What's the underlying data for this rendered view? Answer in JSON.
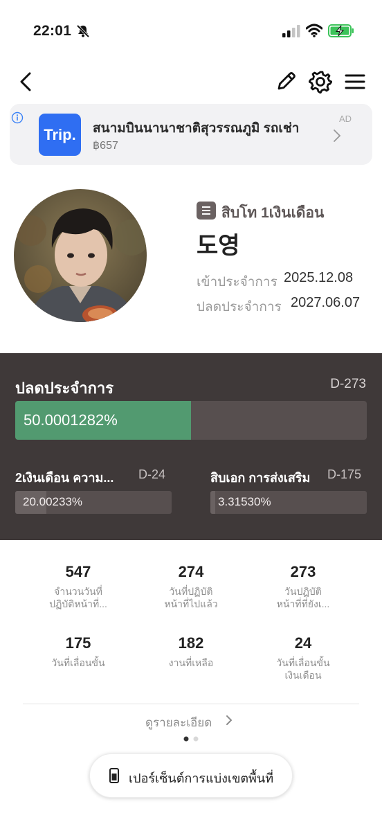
{
  "status_bar": {
    "time": "22:01"
  },
  "ad": {
    "logo_text": "Trip.",
    "title": "สนามบินนานาชาติสุวรรณภูมิ รถเช่า",
    "price": "฿657",
    "tag": "AD"
  },
  "profile": {
    "rank": "สิบโท 1เงินเดือน",
    "name": "도영",
    "enlist_label": "เข้าประจำการ",
    "enlist_date": "2025.12.08",
    "discharge_label": "ปลดประจำการ",
    "discharge_date": "2027.06.07"
  },
  "progress": {
    "main": {
      "label": "ปลดประจำการ",
      "dday": "D-273",
      "percent_text": "50.0001282%",
      "percent": 50.0001282
    },
    "sub1": {
      "label": "2เงินเดือน ความ...",
      "dday": "D-24",
      "percent_text": "20.00233%",
      "percent": 20.00233
    },
    "sub2": {
      "label": "สิบเอก การส่งเสริม",
      "dday": "D-175",
      "percent_text": "3.31530%",
      "percent": 3.3153
    }
  },
  "stats": [
    {
      "value": "547",
      "label_line1": "จำนวนวันที่",
      "label_line2": "ปฏิบัติหน้าที่..."
    },
    {
      "value": "274",
      "label_line1": "วันที่ปฏิบัติ",
      "label_line2": "หน้าที่ไปแล้ว"
    },
    {
      "value": "273",
      "label_line1": "วันปฏิบัติ",
      "label_line2": "หน้าที่ที่ยังเ..."
    },
    {
      "value": "175",
      "label_line1": "วันที่เลื่อนขั้น",
      "label_line2": ""
    },
    {
      "value": "182",
      "label_line1": "งานที่เหลือ",
      "label_line2": ""
    },
    {
      "value": "24",
      "label_line1": "วันที่เลื่อนขั้น",
      "label_line2": "เงินเดือน"
    }
  ],
  "detail_link": "ดูรายละเอียด",
  "pager": {
    "current": 1,
    "total": 2
  },
  "pill_button": "เปอร์เซ็นต์การแบ่งเขตพื้นที่",
  "colors": {
    "panel_bg": "#3f3939",
    "progress_fill": "#529a70",
    "ad_logo": "#2f6ef2",
    "battery_green": "#3cc35a"
  }
}
